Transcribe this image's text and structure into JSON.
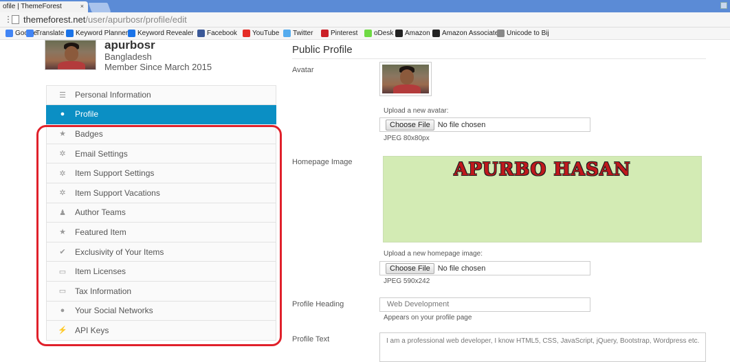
{
  "browser": {
    "tab_title": "ofile | ThemeForest",
    "tab_close": "×",
    "url_host": "themeforest.net",
    "url_path": "/user/apurbosr/profile/edit",
    "bookmarks": [
      {
        "label": "Google",
        "icon": "google-icon",
        "color": "#4285f4"
      },
      {
        "label": "Translate",
        "icon": "translate-icon",
        "color": "#4285f4"
      },
      {
        "label": "Keyword Planner",
        "icon": "keyword-planner-icon",
        "color": "#1a73e8"
      },
      {
        "label": "Keyword Revealer",
        "icon": "keyword-revealer-icon",
        "color": "#1a73e8"
      },
      {
        "label": "Facebook",
        "icon": "facebook-icon",
        "color": "#3b5998"
      },
      {
        "label": "YouTube",
        "icon": "youtube-icon",
        "color": "#e52d27"
      },
      {
        "label": "Twitter",
        "icon": "twitter-icon",
        "color": "#55acee"
      },
      {
        "label": "Pinterest",
        "icon": "pinterest-icon",
        "color": "#cb2027"
      },
      {
        "label": "oDesk",
        "icon": "odesk-icon",
        "color": "#6fda44"
      },
      {
        "label": "Amazon",
        "icon": "amazon-icon",
        "color": "#222"
      },
      {
        "label": "Amazon Associates",
        "icon": "amazon-icon",
        "color": "#222"
      },
      {
        "label": "Unicode to Bij",
        "icon": "page-icon",
        "color": "#888"
      }
    ]
  },
  "profile": {
    "username": "apurbosr",
    "country": "Bangladesh",
    "member_since": "Member Since March 2015"
  },
  "sidebar": {
    "items": [
      {
        "label": "Personal Information",
        "icon": "list-icon",
        "glyph": "☰",
        "active": false
      },
      {
        "label": "Profile",
        "icon": "user-icon",
        "glyph": "●",
        "active": true
      },
      {
        "label": "Badges",
        "icon": "star-icon",
        "glyph": "★",
        "active": false
      },
      {
        "label": "Email Settings",
        "icon": "gear-icon",
        "glyph": "✲",
        "active": false
      },
      {
        "label": "Item Support Settings",
        "icon": "gear-icon",
        "glyph": "✲",
        "active": false
      },
      {
        "label": "Item Support Vacations",
        "icon": "gear-icon",
        "glyph": "✲",
        "active": false
      },
      {
        "label": "Author Teams",
        "icon": "team-icon",
        "glyph": "♟",
        "active": false
      },
      {
        "label": "Featured Item",
        "icon": "star-icon",
        "glyph": "★",
        "active": false
      },
      {
        "label": "Exclusivity of Your Items",
        "icon": "check-icon",
        "glyph": "✔",
        "active": false
      },
      {
        "label": "Item Licenses",
        "icon": "document-icon",
        "glyph": "▭",
        "active": false
      },
      {
        "label": "Tax Information",
        "icon": "document-icon",
        "glyph": "▭",
        "active": false
      },
      {
        "label": "Your Social Networks",
        "icon": "user-icon",
        "glyph": "●",
        "active": false
      },
      {
        "label": "API Keys",
        "icon": "bolt-icon",
        "glyph": "⚡",
        "active": false
      }
    ]
  },
  "main": {
    "title": "Public Profile",
    "avatar_label": "Avatar",
    "upload_avatar_label": "Upload a new avatar:",
    "choose_file": "Choose File",
    "no_file": "No file chosen",
    "avatar_hint": "JPEG 80x80px",
    "homepage_image_label": "Homepage Image",
    "homepage_image_text": "APURBO HASAN",
    "upload_homepage_label": "Upload a new homepage image:",
    "homepage_hint": "JPEG 590x242",
    "profile_heading_label": "Profile Heading",
    "profile_heading_value": "Web Development",
    "profile_heading_hint": "Appears on your profile page",
    "profile_text_label": "Profile Text",
    "profile_text_value": "I am a professional web developer, I know HTML5, CSS, JavaScript, jQuery, Bootstrap, Wordpress etc."
  }
}
